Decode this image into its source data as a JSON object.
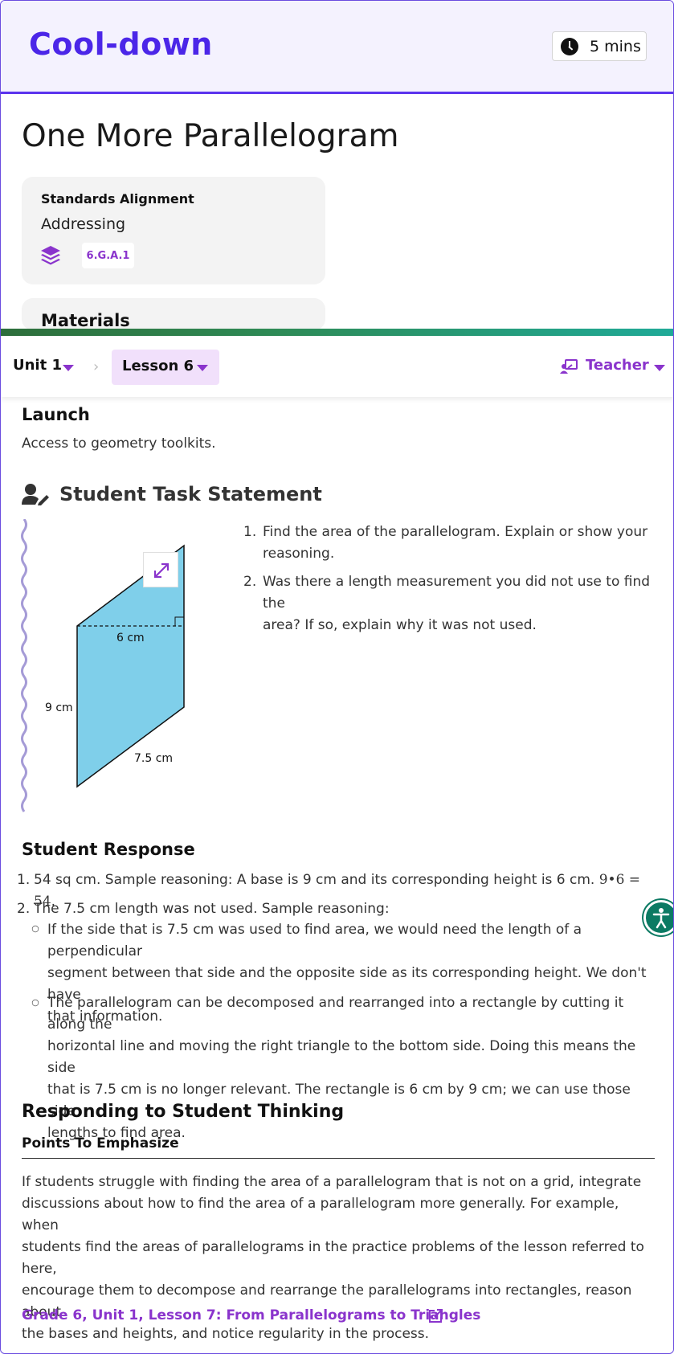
{
  "header": {
    "title": "Cool-down",
    "duration": "5 mins"
  },
  "page_title": "One More Parallelogram",
  "standards": {
    "label": "Standards Alignment",
    "sub": "Addressing",
    "code": "6.G.A.1"
  },
  "materials": {
    "label": "Materials"
  },
  "nav": {
    "unit": "Unit 1",
    "lesson": "Lesson 6",
    "role": "Teacher",
    "accent": "#8a34cc"
  },
  "launch": {
    "title": "Launch",
    "text": "Access to geometry toolkits."
  },
  "task": {
    "title": "Student Task Statement",
    "items": [
      {
        "num": "1.",
        "lines": [
          "Find the area of the parallelogram. Explain or show your",
          "reasoning."
        ]
      },
      {
        "num": "2.",
        "lines": [
          "Was there a length measurement you did not use to find the",
          "area? If so, explain why it was not used."
        ]
      }
    ],
    "figure": {
      "label_base": "6 cm",
      "label_left": "9 cm",
      "label_slant": "7.5 cm",
      "fill": "#7fcfea"
    }
  },
  "response": {
    "title": "Student Response",
    "item1_num": "1.",
    "item1_text": "54 sq cm. Sample reasoning: A base is 9 cm and its corresponding height is 6 cm.",
    "item1_math": "9•6 = 54",
    "item1_end": ".",
    "item2_num": "2.",
    "item2_text": "The 7.5 cm length was not used. Sample reasoning:",
    "bullet1": [
      "If the side that is 7.5 cm was used to find area, we would need the length of a perpendicular",
      "segment between that side and the opposite side as its corresponding height. We don't have",
      "that information."
    ],
    "bullet2": [
      "The parallelogram can be decomposed and rearranged into a rectangle by cutting it along the",
      "horizontal line and moving the right triangle to the bottom side. Doing this means the side",
      "that is 7.5 cm is no longer relevant. The rectangle is 6 cm by 9 cm; we can use those side",
      "lengths to find area."
    ]
  },
  "responding": {
    "title": "Responding to Student Thinking",
    "subtitle": "Points To Emphasize",
    "lines": [
      "If students struggle with finding the area of a parallelogram that is not on a grid, integrate",
      "discussions about how to find the area of a parallelogram more generally. For example, when",
      "students find the areas of parallelograms in the practice problems of the lesson referred to here,",
      "encourage them to decompose and rearrange the parallelograms into rectangles, reason about",
      "the bases and heights, and notice regularity in the process."
    ],
    "link": "Grade 6, Unit 1, Lesson 7: From Parallelograms to Triangles"
  },
  "icons": {
    "clock": "clock-icon",
    "layers": "layers-icon",
    "teacher": "teacher-icon",
    "student": "student-edit-icon",
    "expand": "expand-icon",
    "external": "external-link-icon",
    "accessibility": "accessibility-icon"
  }
}
